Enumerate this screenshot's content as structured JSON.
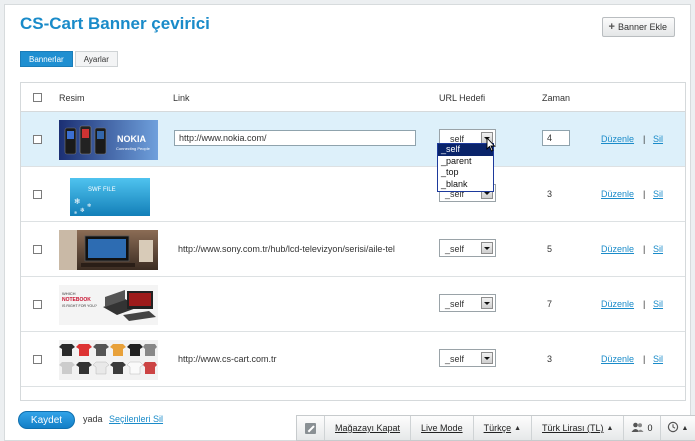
{
  "page": {
    "title": "CS-Cart Banner çevirici",
    "add_button_label": "Banner Ekle"
  },
  "tabs": [
    {
      "label": "Bannerlar",
      "active": true
    },
    {
      "label": "Ayarlar",
      "active": false
    }
  ],
  "table": {
    "headers": {
      "image": "Resim",
      "link": "Link",
      "url_target": "URL Hedefi",
      "time": "Zaman"
    },
    "rows": [
      {
        "image": "nokia-banner",
        "link": "http://www.nokia.com/",
        "target": "_self",
        "time": "4",
        "edit": "Düzenle",
        "sep": "|",
        "delete": "Sil",
        "editing": true
      },
      {
        "image": "swf-file-banner",
        "link": "",
        "target": "_self",
        "time": "3",
        "edit": "Düzenle",
        "sep": "|",
        "delete": "Sil",
        "editing": false
      },
      {
        "image": "sony-tv-banner",
        "link": "http://www.sony.com.tr/hub/lcd-televizyon/serisi/aile-tel",
        "target": "_self",
        "time": "5",
        "edit": "Düzenle",
        "sep": "|",
        "delete": "Sil",
        "editing": false
      },
      {
        "image": "notebook-banner",
        "link": "",
        "target": "_self",
        "time": "7",
        "edit": "Düzenle",
        "sep": "|",
        "delete": "Sil",
        "editing": false
      },
      {
        "image": "tshirts-banner",
        "link": "http://www.cs-cart.com.tr",
        "target": "_self",
        "time": "3",
        "edit": "Düzenle",
        "sep": "|",
        "delete": "Sil",
        "editing": false
      }
    ]
  },
  "dropdown_options": [
    "_self",
    "_parent",
    "_top",
    "_blank"
  ],
  "dropdown_selected": "_self",
  "banner_text": {
    "nokia": "NOKIA",
    "nokia_tagline": "Connecting People",
    "swf": "SWF FILE",
    "notebook": [
      "WHICH",
      "NOTEBOOK",
      "IS RIGHT FOR YOU?"
    ]
  },
  "footer": {
    "save_label": "Kaydet",
    "or_text": "yada",
    "delete_selected": "Seçilenleri Sil"
  },
  "admin_bar": {
    "close_store": "Mağazayı Kapat",
    "live_mode": "Live Mode",
    "language": "Türkçe",
    "currency": "Türk Lirası (TL)",
    "users_count": "0"
  },
  "colors": {
    "accent": "#1a8bc9",
    "row_highlight": "#ddf0fa",
    "save_button": "#1f8fd1"
  }
}
